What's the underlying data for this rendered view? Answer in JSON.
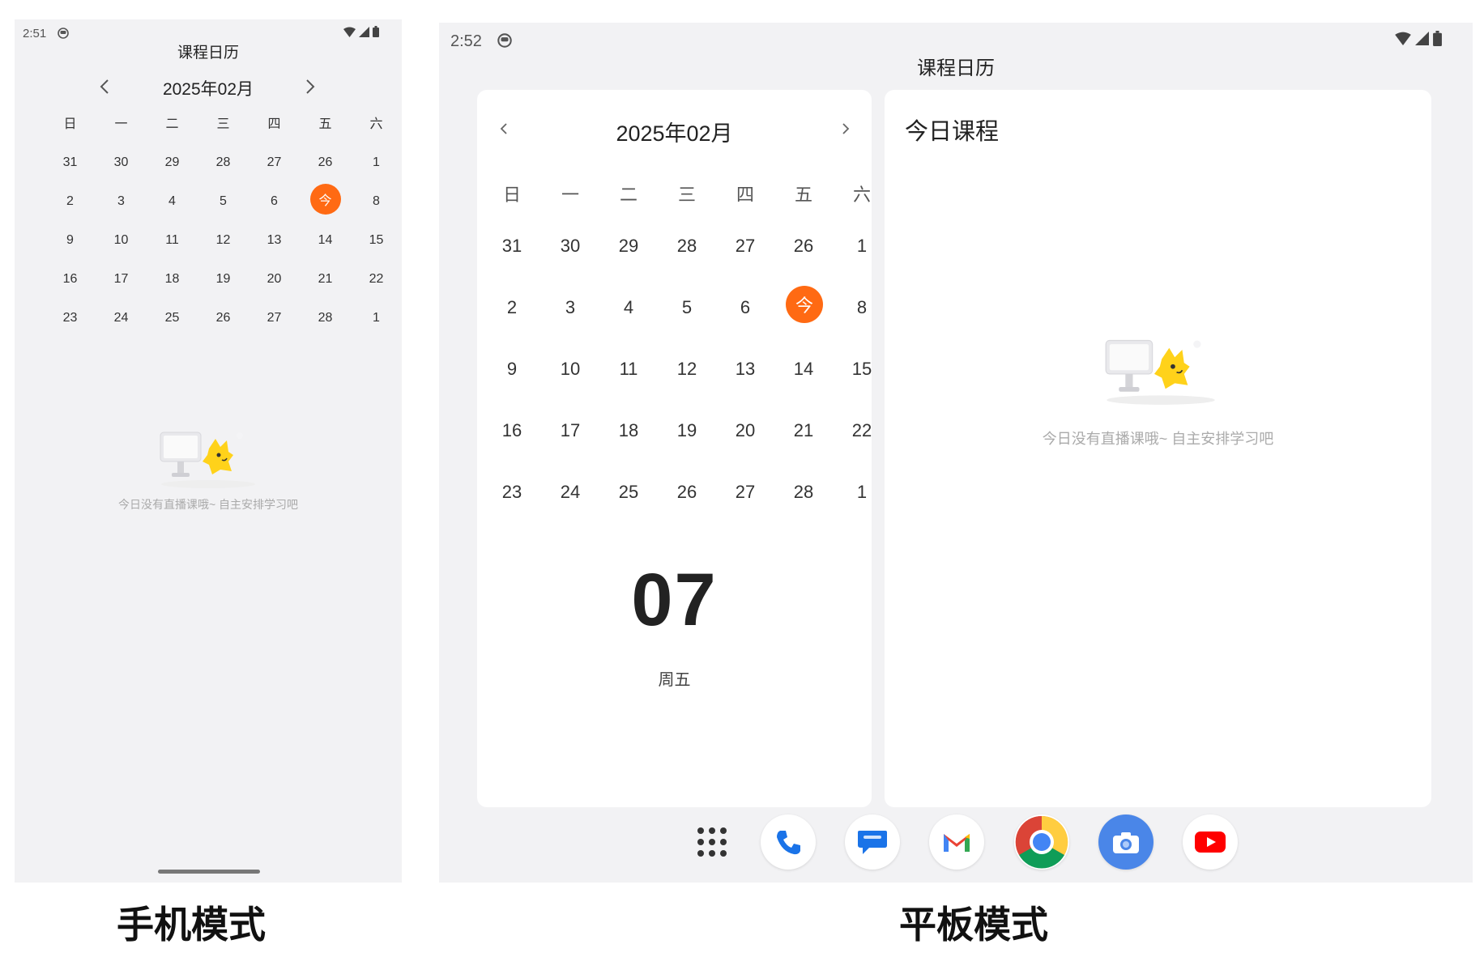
{
  "phone": {
    "status": {
      "time": "2:51"
    },
    "title": "课程日历",
    "month_label": "2025年02月",
    "weekdays": [
      "日",
      "一",
      "二",
      "三",
      "四",
      "五",
      "六"
    ],
    "weeks": [
      [
        {
          "d": "31",
          "muted": true
        },
        {
          "d": "30",
          "muted": true
        },
        {
          "d": "29",
          "muted": true
        },
        {
          "d": "28",
          "muted": true
        },
        {
          "d": "27",
          "muted": true
        },
        {
          "d": "26",
          "muted": true
        },
        {
          "d": "1"
        }
      ],
      [
        {
          "d": "2"
        },
        {
          "d": "3"
        },
        {
          "d": "4"
        },
        {
          "d": "5"
        },
        {
          "d": "6"
        },
        {
          "d": "今",
          "today": true
        },
        {
          "d": "8"
        }
      ],
      [
        {
          "d": "9"
        },
        {
          "d": "10"
        },
        {
          "d": "11"
        },
        {
          "d": "12"
        },
        {
          "d": "13"
        },
        {
          "d": "14"
        },
        {
          "d": "15"
        }
      ],
      [
        {
          "d": "16"
        },
        {
          "d": "17"
        },
        {
          "d": "18"
        },
        {
          "d": "19"
        },
        {
          "d": "20"
        },
        {
          "d": "21"
        },
        {
          "d": "22"
        }
      ],
      [
        {
          "d": "23"
        },
        {
          "d": "24"
        },
        {
          "d": "25"
        },
        {
          "d": "26"
        },
        {
          "d": "27"
        },
        {
          "d": "28"
        },
        {
          "d": "1",
          "muted": true
        }
      ]
    ],
    "empty_text": "今日没有直播课哦~ 自主安排学习吧",
    "caption": "手机模式"
  },
  "tablet": {
    "status": {
      "time": "2:52"
    },
    "title": "课程日历",
    "month_label": "2025年02月",
    "weekdays": [
      "日",
      "一",
      "二",
      "三",
      "四",
      "五",
      "六"
    ],
    "weeks": [
      [
        {
          "d": "31",
          "muted": true
        },
        {
          "d": "30",
          "muted": true
        },
        {
          "d": "29",
          "muted": true
        },
        {
          "d": "28",
          "muted": true
        },
        {
          "d": "27",
          "muted": true
        },
        {
          "d": "26",
          "muted": true
        },
        {
          "d": "1"
        }
      ],
      [
        {
          "d": "2"
        },
        {
          "d": "3"
        },
        {
          "d": "4"
        },
        {
          "d": "5"
        },
        {
          "d": "6"
        },
        {
          "d": "今",
          "today": true
        },
        {
          "d": "8"
        }
      ],
      [
        {
          "d": "9"
        },
        {
          "d": "10"
        },
        {
          "d": "11"
        },
        {
          "d": "12"
        },
        {
          "d": "13"
        },
        {
          "d": "14"
        },
        {
          "d": "15"
        }
      ],
      [
        {
          "d": "16"
        },
        {
          "d": "17"
        },
        {
          "d": "18"
        },
        {
          "d": "19"
        },
        {
          "d": "20"
        },
        {
          "d": "21"
        },
        {
          "d": "22"
        }
      ],
      [
        {
          "d": "23"
        },
        {
          "d": "24"
        },
        {
          "d": "25"
        },
        {
          "d": "26"
        },
        {
          "d": "27"
        },
        {
          "d": "28"
        },
        {
          "d": "1",
          "muted": true
        }
      ]
    ],
    "big_day": "07",
    "weekday_label": "周五",
    "today_title": "今日课程",
    "empty_text": "今日没有直播课哦~ 自主安排学习吧",
    "dock": [
      {
        "name": "app-drawer-icon"
      },
      {
        "name": "phone-app-icon"
      },
      {
        "name": "messages-app-icon"
      },
      {
        "name": "gmail-app-icon"
      },
      {
        "name": "chrome-app-icon"
      },
      {
        "name": "camera-app-icon"
      },
      {
        "name": "youtube-app-icon"
      }
    ],
    "caption": "平板模式"
  },
  "colors": {
    "accent": "#ff6a13",
    "panel_bg": "#f2f2f4",
    "muted_day": "#c6c6c6"
  }
}
